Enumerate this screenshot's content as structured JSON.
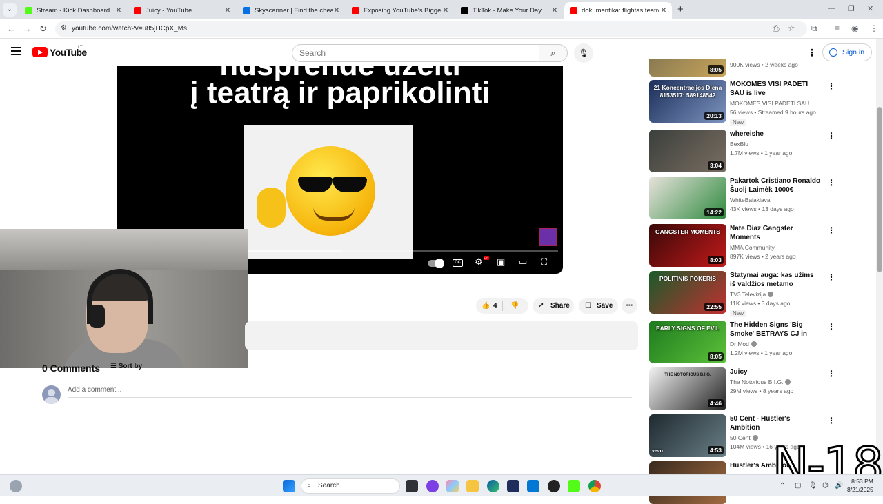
{
  "browser": {
    "tabs": [
      {
        "title": "Stream - Kick Dashboard",
        "color": "#53fc18"
      },
      {
        "title": "Juicy - YouTube",
        "color": "#ff0000"
      },
      {
        "title": "Skyscanner | Find the cheapest",
        "color": "#0770e3"
      },
      {
        "title": "Exposing YouTube's Biggest Fal",
        "color": "#ff0000"
      },
      {
        "title": "TikTok - Make Your Day",
        "color": "#000000"
      },
      {
        "title": "dokumentika: flightas teatre - Y",
        "color": "#ff0000"
      }
    ],
    "active_tab": 5,
    "url": "youtube.com/watch?v=u85jHCpX_Ms"
  },
  "youtube": {
    "logo_text": "YouTube",
    "country": "LT",
    "search_placeholder": "Search",
    "sign_in": "Sign in"
  },
  "player": {
    "caption_line1": "nusprendė užeiti",
    "caption_line2": "į teatrą ir paprikolinti",
    "cc_label": "CC",
    "hd_label": "HD",
    "progress_fraction": 0.3
  },
  "actions": {
    "likes": "4",
    "share": "Share",
    "save": "Save"
  },
  "comments": {
    "heading": "0 Comments",
    "sort": "Sort by",
    "add_placeholder": "Add a comment..."
  },
  "recommendations": [
    {
      "title": "",
      "channel": "",
      "meta": "900K views • 2 weeks ago",
      "duration": "8:05",
      "new": false,
      "verified": false,
      "colors": [
        "#8a7a52",
        "#c9a65a"
      ]
    },
    {
      "title": "MOKOMES VISI PADETI SAU is live",
      "channel": "MOKOMES VISI PADETI SAU",
      "meta": "56 views • Streamed 9 hours ago",
      "duration": "20:13",
      "new": true,
      "verified": false,
      "overlay": "21 Koncentracijos Diena 8153517: 589148542",
      "colors": [
        "#1c2e5a",
        "#7d95c0"
      ]
    },
    {
      "title": "whereishe_",
      "channel": "BexBlu",
      "meta": "1.7M views • 1 year ago",
      "duration": "3:04",
      "new": false,
      "verified": false,
      "colors": [
        "#3b3f3c",
        "#7a6e62"
      ]
    },
    {
      "title": "Pakartok Cristiano Ronaldo Šuolį Laimėk 1000€",
      "channel": "WhiteBalaklava",
      "meta": "43K views • 13 days ago",
      "duration": "14:22",
      "new": false,
      "verified": false,
      "colors": [
        "#e8e2dc",
        "#2d8a3e"
      ]
    },
    {
      "title": "Nate Diaz Gangster Moments",
      "channel": "MMA Community",
      "meta": "897K views • 2 years ago",
      "duration": "8:03",
      "new": false,
      "verified": false,
      "overlay": "GANGSTER MOMENTS",
      "colors": [
        "#3a0808",
        "#c21a1a"
      ]
    },
    {
      "title": "Statymai auga: kas užims iš valdžios metamo Skvernelio ...",
      "channel": "TV3 Televizija",
      "meta": "11K views • 3 days ago",
      "duration": "22:55",
      "new": true,
      "verified": true,
      "overlay": "POLITINIS POKERIS",
      "colors": [
        "#1a5a2a",
        "#c23030"
      ]
    },
    {
      "title": "The Hidden Signs 'Big Smoke' BETRAYS CJ in GTA San ...",
      "channel": "Dr Mod",
      "meta": "1.2M views • 1 year ago",
      "duration": "8:05",
      "new": false,
      "verified": true,
      "overlay": "EARLY SIGNS OF EVIL",
      "colors": [
        "#1e7a1e",
        "#5cc23a"
      ]
    },
    {
      "title": "Juicy",
      "channel": "The Notorious B.I.G.",
      "meta": "29M views • 8 years ago",
      "duration": "4:46",
      "new": false,
      "verified": true,
      "overlay": "THE NOTORIOUS B.I.G.",
      "colors": [
        "#f2f2f2",
        "#222222"
      ]
    },
    {
      "title": "50 Cent - Hustler's Ambition",
      "channel": "50 Cent",
      "meta": "104M views • 16 years ago",
      "duration": "4:53",
      "new": false,
      "verified": true,
      "overlay": "vevo",
      "colors": [
        "#1f2a30",
        "#6a7f86"
      ]
    },
    {
      "title": "Hustler's Ambition",
      "channel": "",
      "meta": "",
      "duration": "",
      "new": false,
      "verified": false,
      "colors": [
        "#3a2a1e",
        "#a06a40"
      ]
    }
  ],
  "watermark": "N-18",
  "taskbar": {
    "search": "Search",
    "date": "8/21/2025",
    "time": "8:53 PM"
  }
}
